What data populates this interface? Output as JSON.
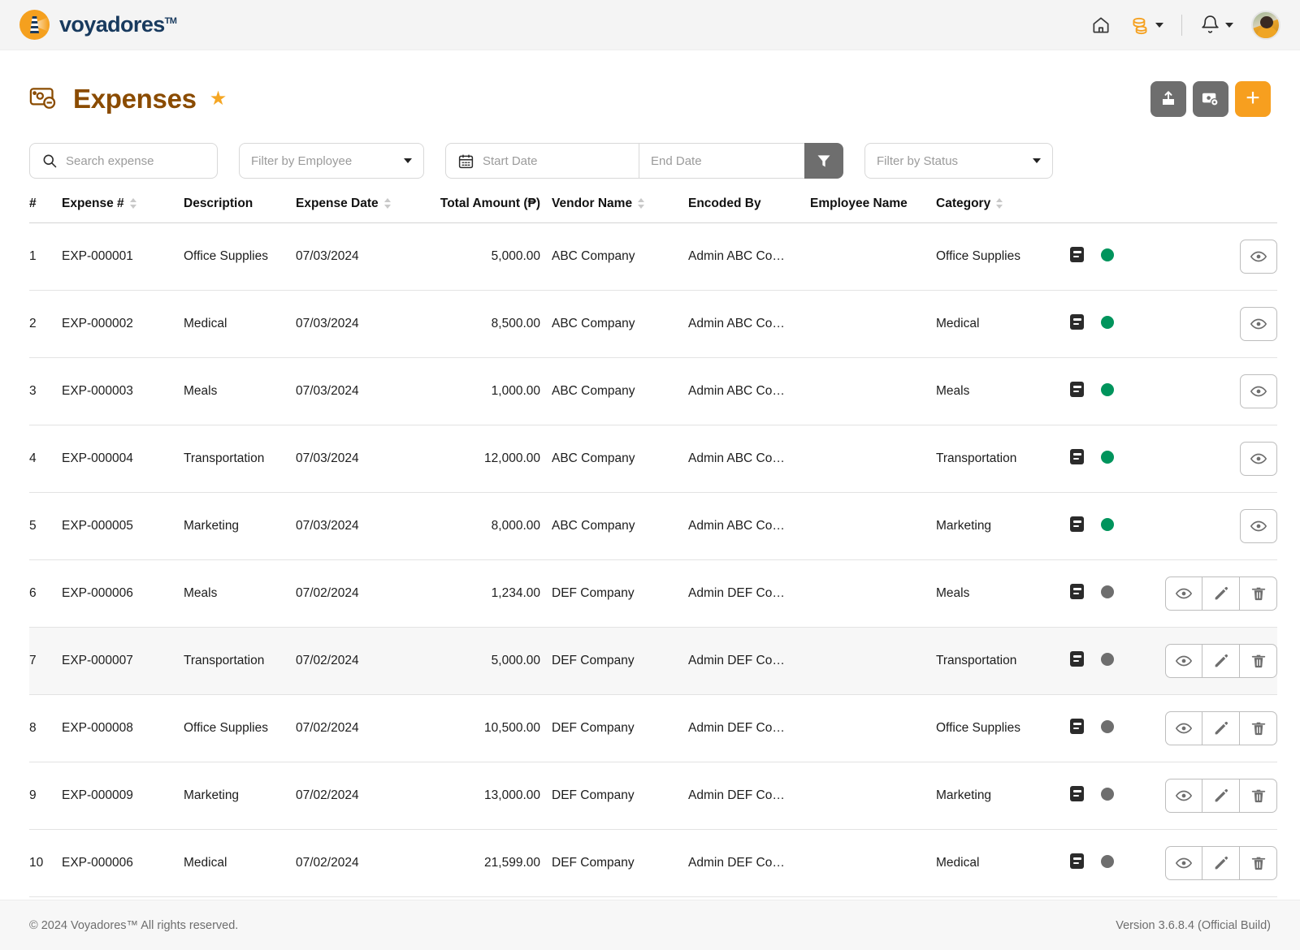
{
  "topbar": {
    "brand_name": "voyadores",
    "brand_tm": "TM",
    "icons": {
      "home": "home-icon",
      "coins": "coins-icon",
      "bell": "bell-icon",
      "avatar": "user-avatar"
    }
  },
  "page": {
    "title": "Expenses",
    "favorite_star": "★",
    "actions": {
      "export_label": "export-icon",
      "expense_card_label": "expense-card-icon",
      "add_label": "+"
    }
  },
  "filters": {
    "search_placeholder": "Search expense",
    "employee_placeholder": "Filter by Employee",
    "start_date_placeholder": "Start Date",
    "end_date_placeholder": "End Date",
    "status_placeholder": "Filter by Status",
    "apply_icon": "funnel-icon"
  },
  "table": {
    "columns": [
      {
        "key": "idx",
        "label": "#",
        "sortable": false,
        "align": "left"
      },
      {
        "key": "expense",
        "label": "Expense #",
        "sortable": true,
        "align": "left"
      },
      {
        "key": "desc",
        "label": "Description",
        "sortable": false,
        "align": "left"
      },
      {
        "key": "date",
        "label": "Expense Date",
        "sortable": true,
        "align": "left"
      },
      {
        "key": "amount",
        "label": "Total Amount (₱)",
        "sortable": false,
        "align": "right"
      },
      {
        "key": "vendor",
        "label": "Vendor Name",
        "sortable": true,
        "align": "left"
      },
      {
        "key": "encoded",
        "label": "Encoded By",
        "sortable": false,
        "align": "left"
      },
      {
        "key": "employee",
        "label": "Employee Name",
        "sortable": false,
        "align": "left"
      },
      {
        "key": "category",
        "label": "Category",
        "sortable": true,
        "align": "left"
      }
    ],
    "rows": [
      {
        "idx": "1",
        "expense": "EXP-000001",
        "desc": "Office Supplies",
        "date": "07/03/2024",
        "amount": "5,000.00",
        "vendor": "ABC Company",
        "encoded": "Admin ABC Co…",
        "employee": "",
        "category": "Office Supplies",
        "status": "green",
        "actions": [
          "view"
        ]
      },
      {
        "idx": "2",
        "expense": "EXP-000002",
        "desc": "Medical",
        "date": "07/03/2024",
        "amount": "8,500.00",
        "vendor": "ABC Company",
        "encoded": "Admin ABC Co…",
        "employee": "",
        "category": "Medical",
        "status": "green",
        "actions": [
          "view"
        ]
      },
      {
        "idx": "3",
        "expense": "EXP-000003",
        "desc": "Meals",
        "date": "07/03/2024",
        "amount": "1,000.00",
        "vendor": "ABC Company",
        "encoded": "Admin ABC Co…",
        "employee": "",
        "category": "Meals",
        "status": "green",
        "actions": [
          "view"
        ]
      },
      {
        "idx": "4",
        "expense": "EXP-000004",
        "desc": "Transportation",
        "date": "07/03/2024",
        "amount": "12,000.00",
        "vendor": "ABC Company",
        "encoded": "Admin ABC Co…",
        "employee": "",
        "category": "Transportation",
        "status": "green",
        "actions": [
          "view"
        ]
      },
      {
        "idx": "5",
        "expense": "EXP-000005",
        "desc": "Marketing",
        "date": "07/03/2024",
        "amount": "8,000.00",
        "vendor": "ABC Company",
        "encoded": "Admin ABC Co…",
        "employee": "",
        "category": "Marketing",
        "status": "green",
        "actions": [
          "view"
        ]
      },
      {
        "idx": "6",
        "expense": "EXP-000006",
        "desc": "Meals",
        "date": "07/02/2024",
        "amount": "1,234.00",
        "vendor": "DEF Company",
        "encoded": "Admin DEF Co…",
        "employee": "",
        "category": "Meals",
        "status": "grey",
        "actions": [
          "view",
          "edit",
          "delete"
        ]
      },
      {
        "idx": "7",
        "expense": "EXP-000007",
        "desc": "Transportation",
        "date": "07/02/2024",
        "amount": "5,000.00",
        "vendor": "DEF Company",
        "encoded": "Admin DEF Co…",
        "employee": "",
        "category": "Transportation",
        "status": "grey",
        "actions": [
          "view",
          "edit",
          "delete"
        ],
        "highlight": true
      },
      {
        "idx": "8",
        "expense": "EXP-000008",
        "desc": "Office Supplies",
        "date": "07/02/2024",
        "amount": "10,500.00",
        "vendor": "DEF Company",
        "encoded": "Admin DEF Co…",
        "employee": "",
        "category": "Office Supplies",
        "status": "grey",
        "actions": [
          "view",
          "edit",
          "delete"
        ]
      },
      {
        "idx": "9",
        "expense": "EXP-000009",
        "desc": "Marketing",
        "date": "07/02/2024",
        "amount": "13,000.00",
        "vendor": "DEF Company",
        "encoded": "Admin DEF Co…",
        "employee": "",
        "category": "Marketing",
        "status": "grey",
        "actions": [
          "view",
          "edit",
          "delete"
        ]
      },
      {
        "idx": "10",
        "expense": "EXP-000006",
        "desc": "Medical",
        "date": "07/02/2024",
        "amount": "21,599.00",
        "vendor": "DEF Company",
        "encoded": "Admin DEF Co…",
        "employee": "",
        "category": "Medical",
        "status": "grey",
        "actions": [
          "view",
          "edit",
          "delete"
        ]
      }
    ]
  },
  "footer": {
    "copyright": "© 2024 Voyadores™ All rights reserved.",
    "version": "Version 3.6.8.4 (Official Build)"
  },
  "colors": {
    "brand_orange": "#f5a01e",
    "brand_navy": "#183a5e",
    "title_brown": "#8a4b00",
    "status_green": "#00945c",
    "status_grey": "#6e6e6e",
    "button_grey": "#6e6e6e"
  }
}
